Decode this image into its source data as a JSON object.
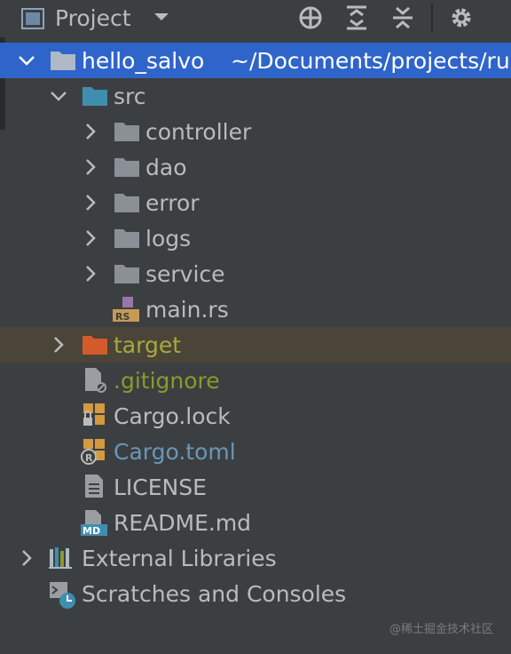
{
  "panel": {
    "title": "Project"
  },
  "tree": {
    "root": {
      "name": "hello_salvo",
      "path": "~/Documents/projects/ru"
    },
    "src": "src",
    "folders": [
      "controller",
      "dao",
      "error",
      "logs",
      "service"
    ],
    "main_file": "main.rs",
    "target": "target",
    "files": [
      ".gitignore",
      "Cargo.lock",
      "Cargo.toml",
      "LICENSE",
      "README.md"
    ],
    "external": "External Libraries",
    "scratches": "Scratches and Consoles"
  },
  "icons": {
    "rs_badge": "RS",
    "md_badge": "MD"
  },
  "colors": {
    "background": "#3c3f41",
    "selection": "#2f65ca",
    "folder": "#8a9096",
    "src_folder": "#3f8eb0",
    "target_folder": "#d35a2a"
  },
  "watermark": "@稀土掘金技术社区"
}
